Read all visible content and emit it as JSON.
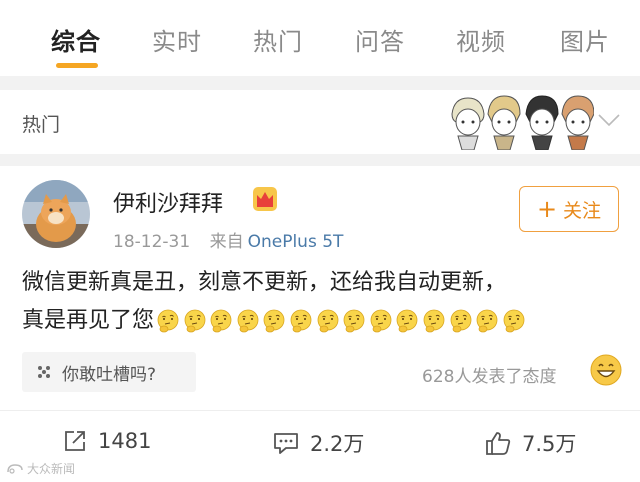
{
  "tabs": [
    {
      "label": "综合",
      "active": true
    },
    {
      "label": "实时"
    },
    {
      "label": "热门"
    },
    {
      "label": "问答"
    },
    {
      "label": "视频"
    },
    {
      "label": "图片"
    }
  ],
  "accent_color": "#f5a623",
  "hot_section": {
    "title": "热门",
    "chevron_icon": "chevron-down-icon"
  },
  "post": {
    "username": "伊利沙拜拜",
    "badge_icon": "crown-icon",
    "date": "18-12-31",
    "source_prefix": "来自",
    "source": "OnePlus 5T",
    "follow_label": "关注",
    "text_line1": "微信更新真是丑，刻意不更新，还给我自动更新，",
    "text_line2": "真是再见了您",
    "emoji_count": 14,
    "emoji_icon": "thinking-face-emoji"
  },
  "comment_prompt": {
    "placeholder": "你敢吐槽吗?",
    "icon": "pen-icon"
  },
  "attitude_text": "628人发表了态度",
  "attitude_icon": "grin-emoji",
  "actions": {
    "repost_count": "1481",
    "comment_count": "2.2万",
    "like_count": "7.5万"
  },
  "watermark": "大众新闻"
}
